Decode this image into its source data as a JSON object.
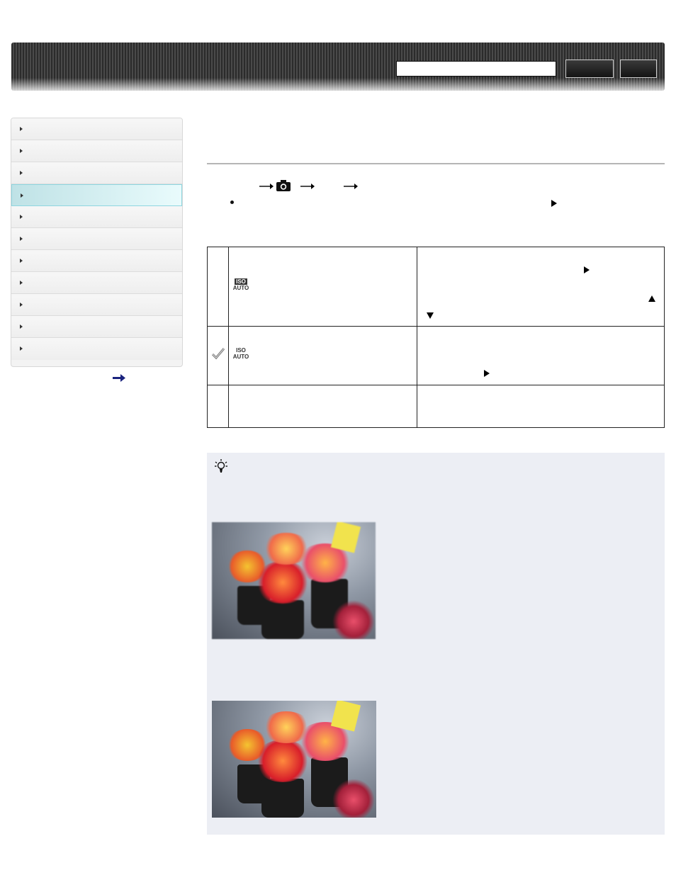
{
  "header": {
    "search": {
      "value": "",
      "placeholder": ""
    },
    "search_button_label": "",
    "top_button_label": ""
  },
  "sidebar": {
    "items": [
      {
        "label": "",
        "active": false
      },
      {
        "label": "",
        "active": false
      },
      {
        "label": "",
        "active": false
      },
      {
        "label": "",
        "active": true
      },
      {
        "label": "",
        "active": false
      },
      {
        "label": "",
        "active": false
      },
      {
        "label": "",
        "active": false
      },
      {
        "label": "",
        "active": false
      },
      {
        "label": "",
        "active": false
      },
      {
        "label": "",
        "active": false
      },
      {
        "label": "",
        "active": false
      }
    ],
    "more_icon": "arrow-right-icon"
  },
  "main": {
    "title": "",
    "menu_path_icons": [
      "arrow-right-icon",
      "camera-icon",
      "arrow-right-icon",
      "arrow-right-icon"
    ],
    "note_bullet": "",
    "table": {
      "rows": [
        {
          "icon": "iso-auto-dark-icon",
          "selected": false,
          "setting": "",
          "description": ""
        },
        {
          "icon": "iso-auto-icon",
          "selected": true,
          "setting": "",
          "description": ""
        },
        {
          "icon": "",
          "selected": false,
          "setting": "",
          "description": ""
        }
      ],
      "icon_texts": {
        "iso": "ISO",
        "auto": "AUTO"
      }
    },
    "hint": {
      "icon": "lightbulb-icon",
      "photos": [
        {
          "subject": "flowers-in-pots-photo"
        },
        {
          "subject": "flowers-in-pots-photo"
        }
      ]
    }
  },
  "colors": {
    "active_item": "#bfe2e6",
    "hint_panel": "#eceef4",
    "rule": "#b5b5b5"
  }
}
